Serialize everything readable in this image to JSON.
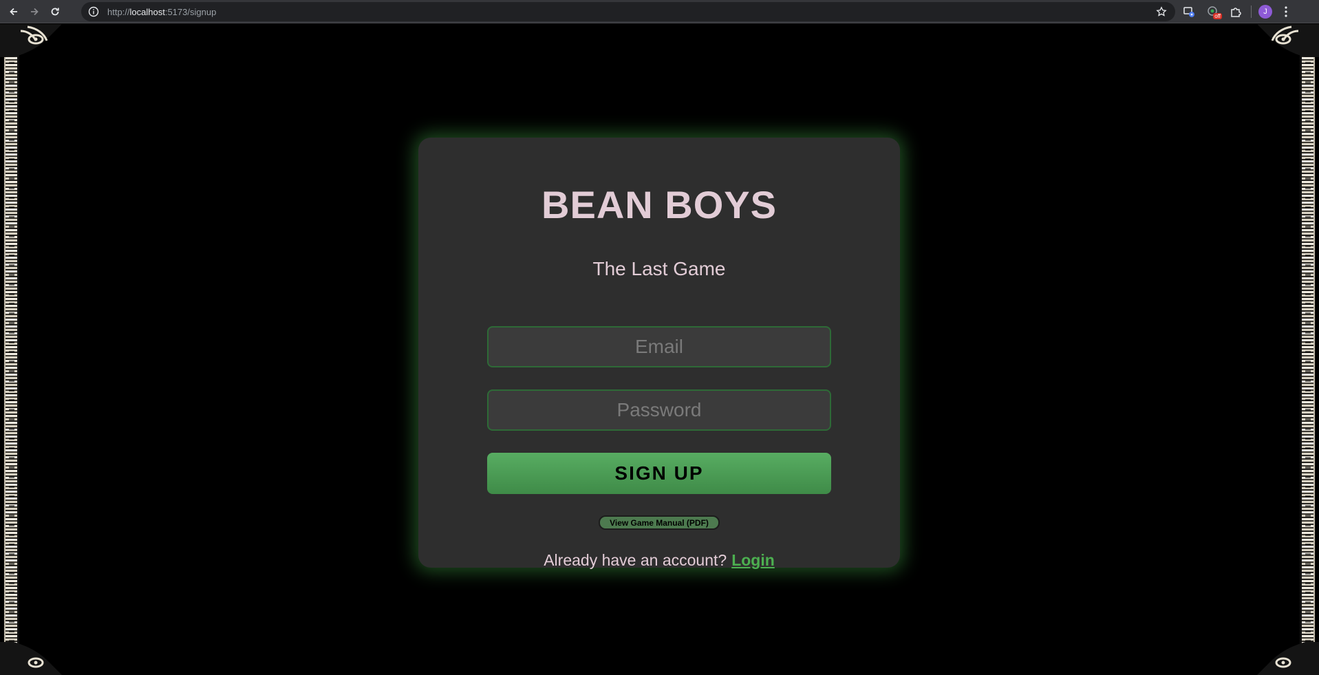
{
  "browser": {
    "url_scheme": "http://",
    "url_host": "localhost",
    "url_path": ":5173/signup",
    "avatar_letter": "J",
    "extension_badge": "off",
    "icons": [
      "back-icon",
      "forward-icon",
      "reload-icon",
      "info-icon",
      "star-icon",
      "extension-icon",
      "puzzle-icon",
      "menu-icon"
    ]
  },
  "signup": {
    "title": "BEAN BOYS",
    "subtitle": "The Last Game",
    "email_placeholder": "Email",
    "password_placeholder": "Password",
    "signup_label": "SIGN UP",
    "manual_label": "View Game Manual (PDF)",
    "login_prompt": "Already have an account?",
    "login_link": "Login"
  },
  "colors": {
    "accent_green": "#4caf50",
    "card_background": "#2e2e2e",
    "title_color": "#e2ccd6",
    "page_background": "#000000"
  }
}
